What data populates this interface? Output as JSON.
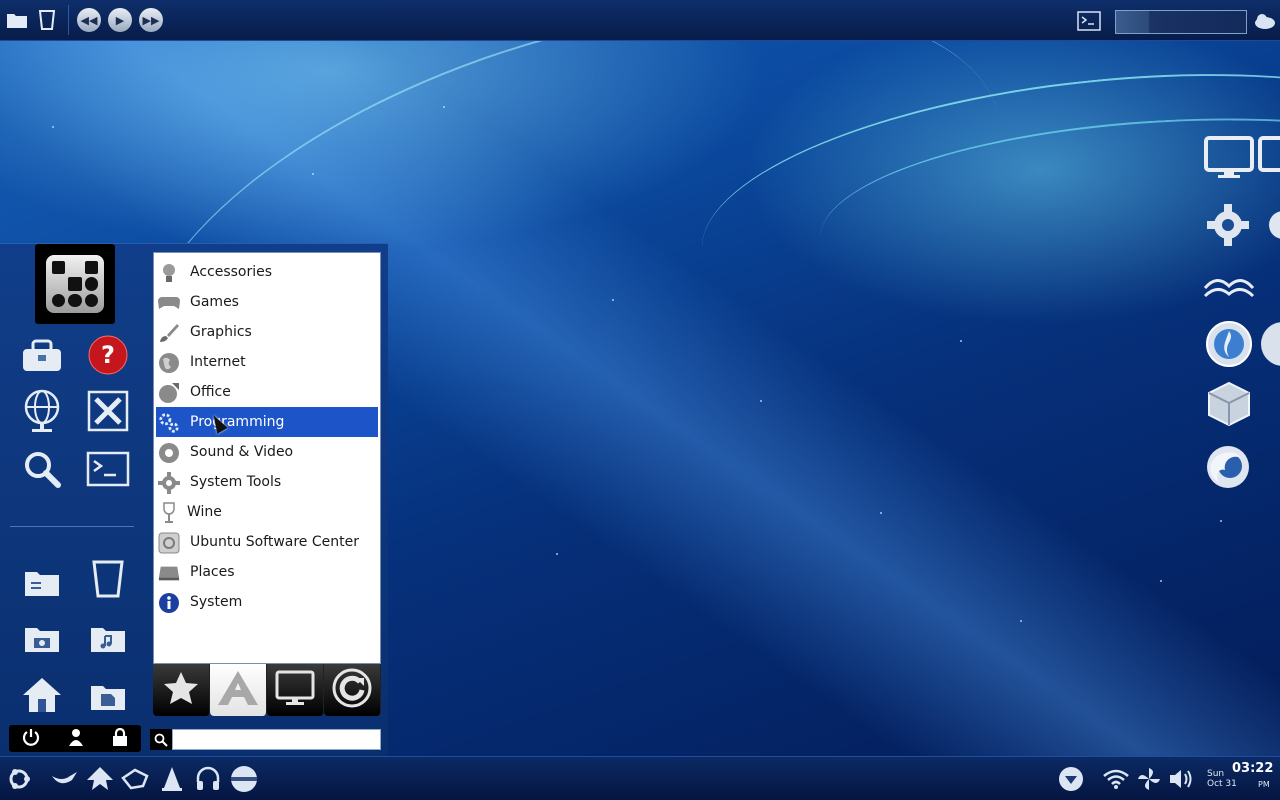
{
  "top_panel": {
    "icons": [
      "folder-icon",
      "trash-icon",
      "previous-icon",
      "play-icon",
      "next-icon",
      "terminal-icon",
      "weather-icon"
    ],
    "search": {
      "value": "",
      "placeholder": ""
    }
  },
  "right_dock": {
    "icons": [
      "monitor-icon",
      "gear-icon",
      "openoffice-icon",
      "burner-icon",
      "virtualbox-icon",
      "firefox-icon"
    ]
  },
  "launcher": {
    "favorites": [
      "toolbox-icon",
      "help-icon",
      "network-globe-icon",
      "settings-tools-icon",
      "search-icon",
      "terminal-icon"
    ],
    "places": [
      "documents-folder-icon",
      "trash-icon",
      "pictures-folder-icon",
      "music-folder-icon",
      "home-icon",
      "videos-folder-icon"
    ],
    "session": [
      "power-icon",
      "user-switch-icon",
      "lock-icon"
    ]
  },
  "menu": {
    "items": [
      {
        "label": "Accessories",
        "icon": "lightbulb-icon",
        "selected": false
      },
      {
        "label": "Games",
        "icon": "gamepad-icon",
        "selected": false
      },
      {
        "label": "Graphics",
        "icon": "brush-icon",
        "selected": false
      },
      {
        "label": "Internet",
        "icon": "globe-icon",
        "selected": false
      },
      {
        "label": "Office",
        "icon": "office-icon",
        "selected": false
      },
      {
        "label": "Programming",
        "icon": "gears-icon",
        "selected": true
      },
      {
        "label": "Sound & Video",
        "icon": "media-icon",
        "selected": false
      },
      {
        "label": "System Tools",
        "icon": "gear-icon",
        "selected": false
      },
      {
        "label": "Wine",
        "icon": "wine-glass-icon",
        "selected": false
      },
      {
        "label": "Ubuntu Software Center",
        "icon": "software-center-icon",
        "selected": false
      },
      {
        "label": "Places",
        "icon": "drive-icon",
        "selected": false
      },
      {
        "label": "System",
        "icon": "info-icon",
        "selected": false
      }
    ],
    "tabs": [
      {
        "name": "favorites",
        "icon": "star-icon",
        "active": false
      },
      {
        "name": "applications",
        "icon": "letter-a-icon",
        "active": true
      },
      {
        "name": "computer",
        "icon": "monitor-icon",
        "active": false
      },
      {
        "name": "recent",
        "icon": "refresh-icon",
        "active": false
      }
    ],
    "search": {
      "value": "",
      "placeholder": ""
    }
  },
  "bottom_panel": {
    "icons": [
      "ubuntu-menu-icon",
      "gimp-icon",
      "inkscape-icon",
      "xchat-icon",
      "vlc-icon",
      "headphones-icon",
      "disc-icon"
    ],
    "tray": [
      "download-icon",
      "wifi-icon",
      "pinwheel-icon",
      "volume-icon"
    ],
    "clock": {
      "day": "Sun",
      "date": "Oct 31",
      "time": "03:22",
      "ampm": "PM"
    }
  },
  "colors": {
    "selection": "#1d55c9",
    "panel": "#071c49"
  }
}
